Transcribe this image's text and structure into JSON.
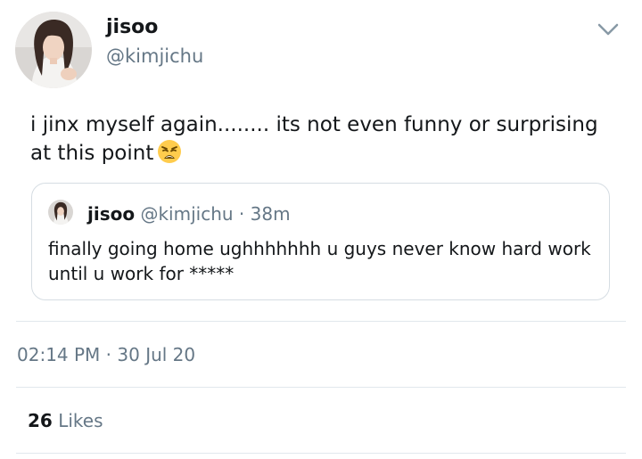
{
  "author": {
    "display_name": "jisoo",
    "handle": "@kimjichu"
  },
  "tweet": {
    "text": "i jinx myself again........ its not even funny or surprising at this point",
    "emoji": "weary-face-emoji"
  },
  "quoted_tweet": {
    "display_name": "jisoo",
    "handle": "@kimjichu",
    "separator": "·",
    "time_ago": "38m",
    "text": "finally going home ughhhhhhh u guys never know hard work until u work for *****"
  },
  "meta": {
    "timestamp": "02:14 PM · 30 Jul 20",
    "likes_count": "26",
    "likes_label": "Likes"
  },
  "icons": {
    "menu": "chevron-down-icon"
  },
  "colors": {
    "text_primary": "#14171a",
    "text_secondary": "#657786",
    "border": "#d6dde3",
    "divider": "#e1e8ed"
  }
}
